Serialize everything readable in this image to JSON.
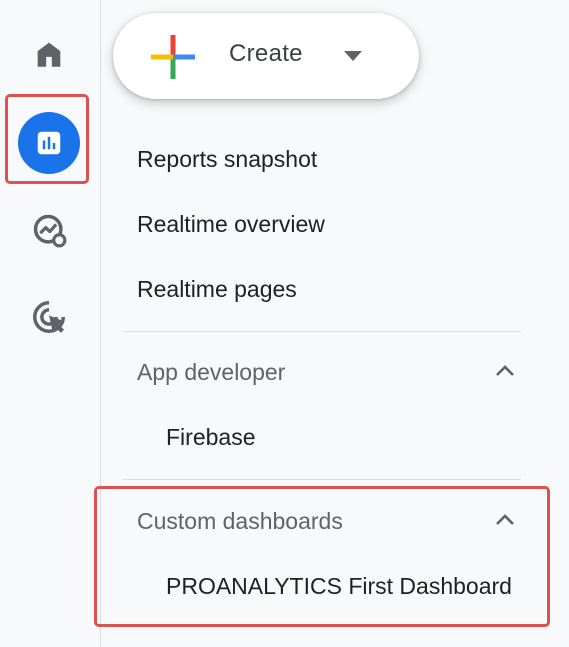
{
  "rail": {
    "items": [
      {
        "name": "home",
        "icon": "home-icon",
        "active": false
      },
      {
        "name": "reports",
        "icon": "bar-chart-icon",
        "active": true
      },
      {
        "name": "explore",
        "icon": "trend-explore-icon",
        "active": false
      },
      {
        "name": "advertising",
        "icon": "target-cursor-icon",
        "active": false
      }
    ]
  },
  "create_button": {
    "label": "Create",
    "icon": "multicolor-plus-icon"
  },
  "nav": {
    "items": [
      "Reports snapshot",
      "Realtime overview",
      "Realtime pages"
    ],
    "sections": [
      {
        "title": "App developer",
        "expanded": true,
        "items": [
          "Firebase"
        ]
      },
      {
        "title": "Custom dashboards",
        "expanded": true,
        "items": [
          "PROANALYTICS First Dashboard"
        ]
      }
    ]
  },
  "colors": {
    "accent": "#1a73e8",
    "highlight_border": "#d9534f",
    "plus_red": "#ea4335",
    "plus_blue": "#4285f4",
    "plus_green": "#34a853",
    "plus_yellow": "#fbbc04"
  }
}
